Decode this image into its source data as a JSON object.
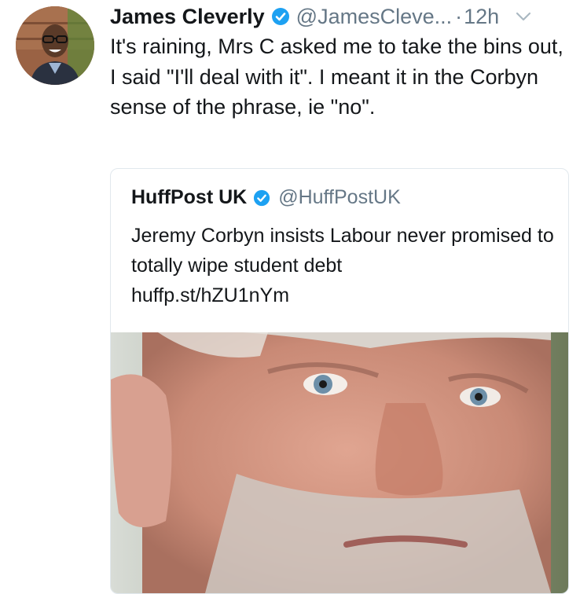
{
  "tweet": {
    "author": {
      "display_name": "James Cleverly",
      "handle": "@JamesCleve...",
      "verified": true,
      "avatar_icon": "profile-photo"
    },
    "separator": "·",
    "time": "12h",
    "menu_icon": "chevron-down-icon",
    "text": "It's raining, Mrs C asked me to take the bins out, I said \"I'll deal with it\". I meant it in the Corbyn sense of the phrase, ie \"no\"."
  },
  "quoted_tweet": {
    "author": {
      "display_name": "HuffPost UK",
      "handle": "@HuffPostUK",
      "verified": true
    },
    "text": "Jeremy Corbyn insists Labour never promised to totally wipe student debt",
    "link": "huffp.st/hZU1nYm",
    "media_icon": "news-photo"
  },
  "colors": {
    "text_primary": "#14171a",
    "text_secondary": "#657786",
    "verified_blue": "#1da1f2",
    "card_border": "#e1e8ed"
  }
}
